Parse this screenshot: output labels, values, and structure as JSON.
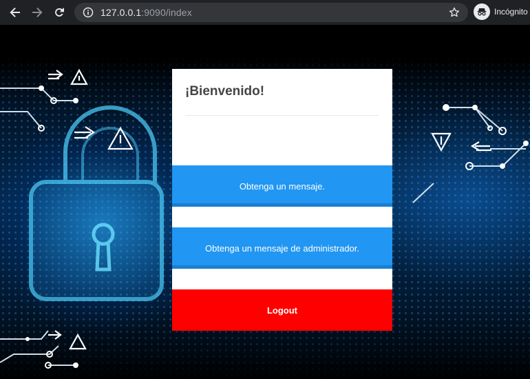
{
  "browser": {
    "url_host": "127.0.0.1",
    "url_path": ":9090/index",
    "profile_label": "Incógnito"
  },
  "card": {
    "title": "¡Bienvenido!",
    "buttons": {
      "get_message": "Obtenga un mensaje.",
      "get_admin_message": "Obtenga un mensaje de administrador.",
      "logout": "Logout"
    }
  },
  "colors": {
    "primary_button": "#2196f3",
    "logout_button": "#ff0000"
  },
  "icons": [
    "back-arrow-icon",
    "forward-arrow-icon",
    "reload-icon",
    "info-icon",
    "star-icon",
    "incognito-icon"
  ]
}
